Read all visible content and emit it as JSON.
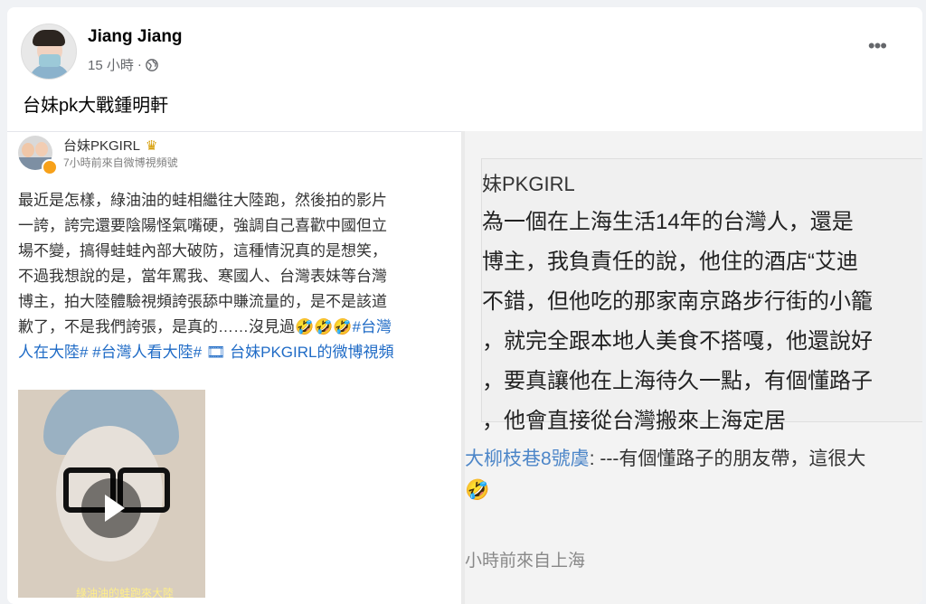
{
  "post": {
    "author": "Jiang Jiang",
    "time": "15 小時",
    "separator": "·",
    "more": "•••",
    "text": "台妹pk大戰鍾明軒"
  },
  "weibo": {
    "name": "台妹PKGIRL",
    "meta": "7小時前來自微博視頻號",
    "text_lines": [
      "最近是怎樣，綠油油的蛙相繼往大陸跑，然後拍的影片",
      "一誇，誇完還要陰陽怪氣嘴硬，強調自己喜歡中國但立",
      "場不變，搞得蛙蛙內部大破防，這種情況真的是想笑，",
      "不過我想說的是，當年罵我、寒國人、台灣表妹等台灣",
      "博主，拍大陸體驗視頻誇張舔中賺流量的，是不是該道"
    ],
    "line6_text": "歉了，不是我們誇張，是真的……沒見過",
    "line6_emojis": "🤣🤣🤣",
    "line6_tag": "#台灣",
    "line7_tags": "人在大陸# #台灣人看大陸# 🎞 台妹PKGIRL的微博視頻",
    "video_caption": "綠油油的蛙跑來大陸"
  },
  "screenshot": {
    "name": "妹PKGIRL",
    "lines": [
      "為一個在上海生活14年的台灣人，還是",
      "博主，我負責任的說，他住的酒店“艾迪",
      "不錯，但他吃的那家南京路步行街的小籠",
      "，就完全跟本地人美食不搭嘎，他還說好",
      "，要真讓他在上海待久一點，有個懂路子",
      "，他會直接從台灣搬來上海定居"
    ],
    "comment_user": "大柳枝巷8號虞",
    "comment_text": ": ---有個懂路子的朋友帶，這很大",
    "comment_emoji": "🤣",
    "time": "小時前來自上海"
  }
}
